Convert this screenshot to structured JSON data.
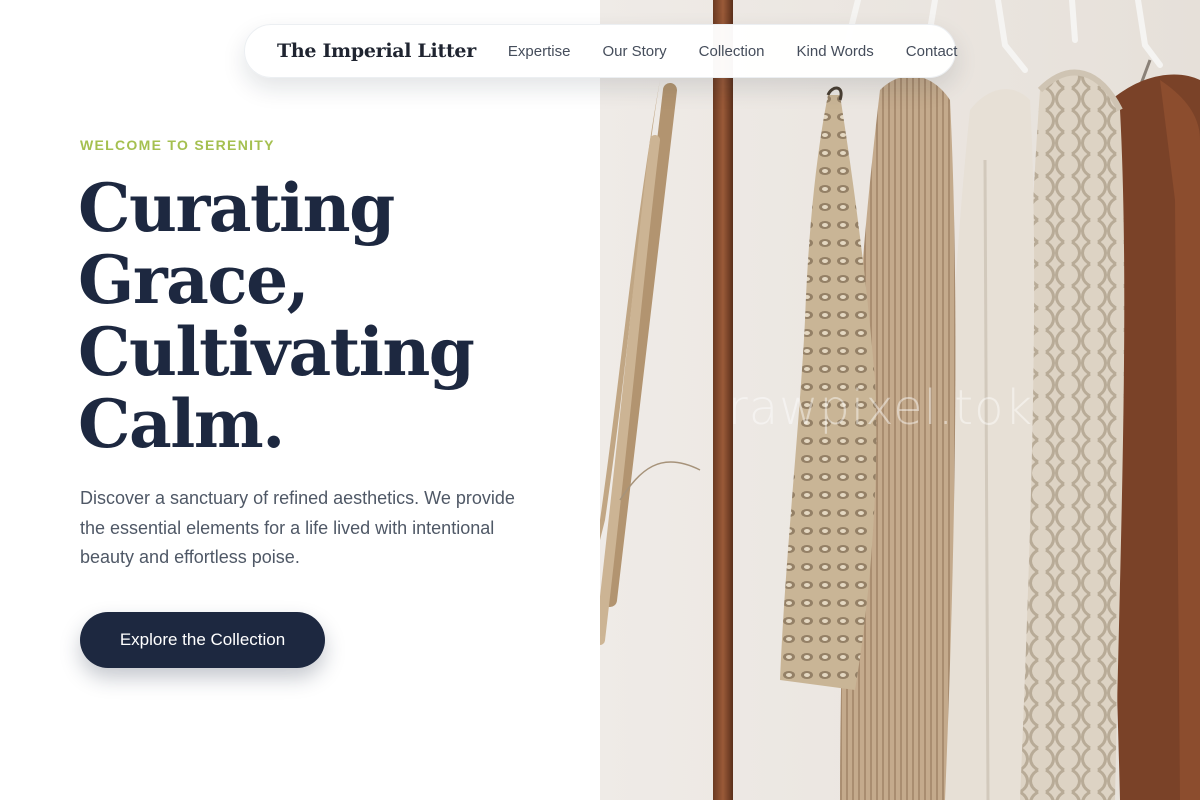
{
  "nav": {
    "brand": "The Imperial Litter",
    "links": [
      "Expertise",
      "Our Story",
      "Collection",
      "Kind Words",
      "Contact"
    ]
  },
  "hero": {
    "eyebrow": "WELCOME TO SERENITY",
    "headline": [
      "Curating",
      "Grace,",
      "Cultivating",
      "Calm."
    ],
    "lead": "Discover a sanctuary of refined aesthetics. We provide the essential elements for a life lived with intentional beauty and effortless poise.",
    "cta_label": "Explore the Collection"
  },
  "image": {
    "subject": "clothing-rack-with-neutral-knitwear",
    "watermark": "rawpixel.tok"
  },
  "colors": {
    "accent": "#a5c050",
    "navy": "#1d2840",
    "body_text": "#4f5866",
    "wall": "#ece8e3"
  }
}
